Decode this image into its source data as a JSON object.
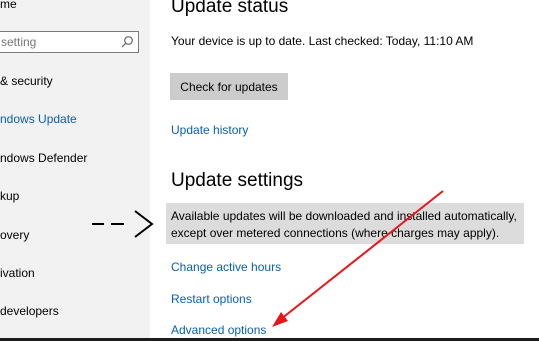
{
  "sidebar": {
    "home": "me",
    "search": {
      "placeholder": "setting"
    },
    "items": [
      {
        "label": "& security"
      },
      {
        "label": "ndows Update"
      },
      {
        "label": "ndows Defender"
      },
      {
        "label": "kup"
      },
      {
        "label": "overy"
      },
      {
        "label": "ivation"
      },
      {
        "label": "developers"
      }
    ]
  },
  "main": {
    "status_heading": "Update status",
    "status_text": "Your device is up to date. Last checked: Today, 11:10 AM",
    "check_button": "Check for updates",
    "history_link": "Update history",
    "settings_heading": "Update settings",
    "notice_line1": "Available updates will be downloaded and installed automatically,",
    "notice_line2": "except over metered connections (where charges may apply).",
    "links": {
      "active_hours": "Change active hours",
      "restart": "Restart options",
      "advanced": "Advanced options"
    }
  },
  "annotations": {
    "arrow_color": "#e8161b",
    "pointer_color": "#000000"
  },
  "colors": {
    "link": "#0a5fb4",
    "sidebar_bg": "#f2f2f2",
    "button_bg": "#cccccc",
    "notice_bg": "#dcdcdc"
  }
}
